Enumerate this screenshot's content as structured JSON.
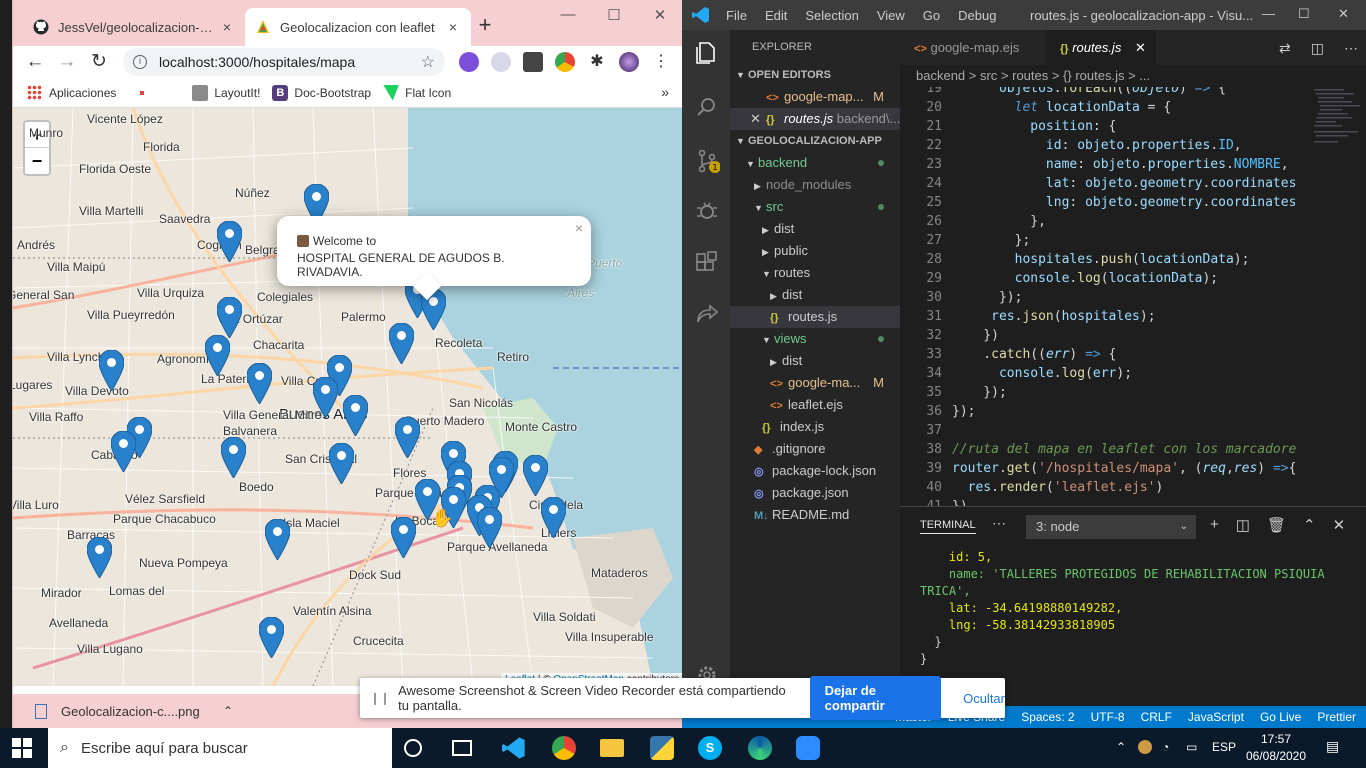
{
  "browser": {
    "tabs": [
      {
        "title": "JessVel/geolocalizacion-hosp",
        "icon": "github-icon"
      },
      {
        "title": "Geolocalizacion con leaflet",
        "icon": "leaflet-icon"
      }
    ],
    "url": "localhost:3000/hospitales/mapa",
    "bookmarks": [
      "Aplicaciones",
      "LayoutIt!",
      "Doc-Bootstrap",
      "Flat Icon"
    ],
    "download": "Geolocalizacion-c....png"
  },
  "map": {
    "zoom_in": "+",
    "zoom_out": "−",
    "popup": {
      "line1": "Welcome to",
      "line2": "HOSPITAL GENERAL DE AGUDOS B. RIVADAVIA.",
      "close": "×"
    },
    "labels": [
      "Vicente López",
      "Munro",
      "Florida",
      "Florida Oeste",
      "Núñez",
      "Villa Martelli",
      "Saavedra",
      "Coghlan",
      "Belgrano",
      "Andrés",
      "Villa Maipú",
      "General San",
      "Villa Urquiza",
      "Colegiales",
      "Palermo",
      "Recoleta",
      "Puerto",
      "Aires",
      "Villa Pueyrredón",
      "Villa Ortúzar",
      "Chacarita",
      "Retiro",
      "Villa Lynch",
      "Agronomía",
      "La Paternal",
      "Villa Crespo",
      "Lugares",
      "Villa Devoto",
      "San Nicolás",
      "Buenos Aires",
      "Villa Raffo",
      "Villa General Mitre",
      "Balvanera",
      "Puerto Madero",
      "Monte Castro",
      "Caballito",
      "San Cristóbal",
      "Flores",
      "Boedo",
      "Vélez Sarsfield",
      "Parque Patricios",
      "La Boca",
      "Ciudadela",
      "Villa Luro",
      "Parque Chacabuco",
      "Isla Maciel",
      "Liniers",
      "Barracas",
      "Parque Avellaneda",
      "Nueva Pompeya",
      "Dock Sud",
      "Mataderos",
      "Lomas del",
      "Mirador",
      "Avellaneda",
      "Villa Soldati",
      "Valentín Alsina",
      "Crucecita",
      "Villa Insuperable",
      "Villa Lugano"
    ],
    "attribution_prefix": "Leaflet",
    "attribution_link": "OpenStreetMap",
    "attribution_suffix": "contributors"
  },
  "vscode": {
    "menu": [
      "File",
      "Edit",
      "Selection",
      "View",
      "Go",
      "Debug"
    ],
    "window_title": "routes.js - geolocalizacion-app - Visu...",
    "explorer_title": "EXPLORER",
    "open_editors_title": "OPEN EDITORS",
    "open_editors": [
      {
        "name": "google-map...",
        "badge": "M"
      },
      {
        "name": "routes.js",
        "path": "backend\\..."
      }
    ],
    "project_title": "GEOLOCALIZACION-APP",
    "tree": [
      {
        "name": "backend",
        "depth": 0,
        "kind": "folder-open"
      },
      {
        "name": "node_modules",
        "depth": 1,
        "kind": "folder"
      },
      {
        "name": "src",
        "depth": 1,
        "kind": "folder-open"
      },
      {
        "name": "dist",
        "depth": 2,
        "kind": "folder"
      },
      {
        "name": "public",
        "depth": 2,
        "kind": "folder"
      },
      {
        "name": "routes",
        "depth": 2,
        "kind": "folder-open"
      },
      {
        "name": "dist",
        "depth": 3,
        "kind": "folder"
      },
      {
        "name": "routes.js",
        "depth": 3,
        "kind": "js"
      },
      {
        "name": "views",
        "depth": 2,
        "kind": "folder-open"
      },
      {
        "name": "dist",
        "depth": 3,
        "kind": "folder"
      },
      {
        "name": "google-ma...",
        "depth": 3,
        "kind": "ejs",
        "badge": "M"
      },
      {
        "name": "leaflet.ejs",
        "depth": 3,
        "kind": "ejs"
      },
      {
        "name": "index.js",
        "depth": 2,
        "kind": "js"
      },
      {
        "name": ".gitignore",
        "depth": 1,
        "kind": "git"
      },
      {
        "name": "package-lock.json",
        "depth": 1,
        "kind": "json"
      },
      {
        "name": "package.json",
        "depth": 1,
        "kind": "json"
      },
      {
        "name": "README.md",
        "depth": 1,
        "kind": "md"
      }
    ],
    "editor_tabs": [
      "google-map.ejs",
      "routes.js"
    ],
    "breadcrumb": "backend > src > routes > {} routes.js > ...",
    "code_start_line": 19,
    "terminal": {
      "tab": "TERMINAL",
      "instance": "3: node",
      "lines": [
        "    id: 5,",
        "    name: 'TALLERES PROTEGIDOS DE REHABILITACION PSIQUIA",
        "TRICA',",
        "    lat: -34.64198880149282,",
        "    lng: -58.38142933818905",
        "  }",
        "}"
      ]
    },
    "status": [
      "master",
      "Live Share",
      "Spaces: 2",
      "UTF-8",
      "CRLF",
      "JavaScript",
      "Go Live",
      "Prettier"
    ]
  },
  "share_bar": {
    "message": "Awesome Screenshot & Screen Video Recorder está compartiendo tu pantalla.",
    "stop": "Dejar de compartir",
    "hide": "Ocultar"
  },
  "taskbar": {
    "search_placeholder": "Escribe aquí para buscar",
    "language": "ESP",
    "time": "17:57",
    "date": "06/08/2020"
  }
}
